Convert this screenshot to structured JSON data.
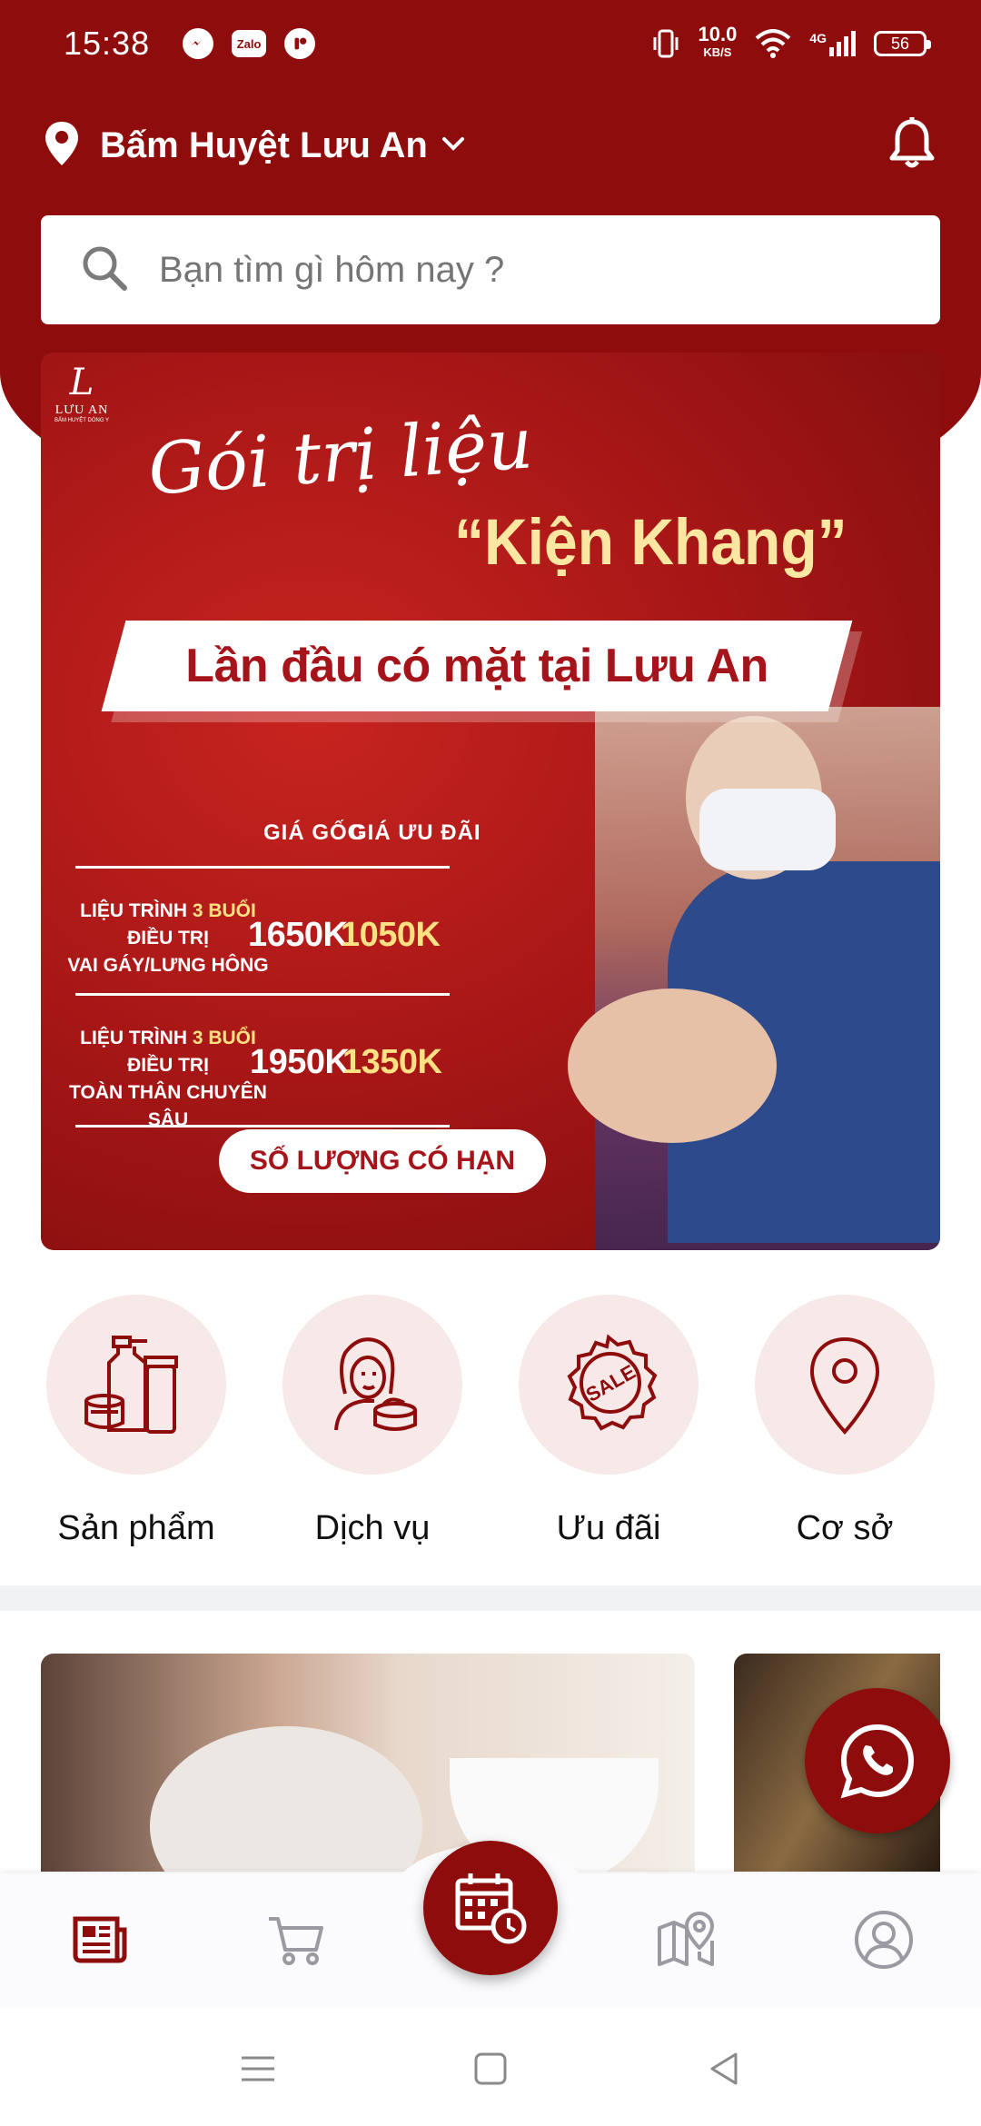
{
  "status_bar": {
    "time": "15:38",
    "net_speed": "10.0",
    "net_unit": "KB/S",
    "signal": "4G",
    "battery": "56",
    "zalo": "Zalo"
  },
  "header": {
    "location": "Bấm Huyệt Lưu An"
  },
  "search": {
    "placeholder": "Bạn tìm gì hôm nay ?"
  },
  "banner": {
    "logo_text": "LƯU AN",
    "logo_sub": "BẤM HUYỆT DÒNG Y",
    "script_title": "Gói trị liệu",
    "title": "“Kiện Khang”",
    "ribbon": "Lần đầu có mặt tại Lưu An",
    "col_original": "GIÁ GỐC",
    "col_sale": "GIÁ ƯU ĐÃI",
    "rows": [
      {
        "line1_a": "LIỆU TRÌNH ",
        "line1_hl": "3 BUỔI",
        "line1_b": " ĐIỀU TRỊ",
        "line2": "VAI GÁY/LƯNG HÔNG",
        "original": "1650K",
        "sale": "1050K"
      },
      {
        "line1_a": "LIỆU TRÌNH ",
        "line1_hl": "3 BUỔI",
        "line1_b": " ĐIỀU TRỊ",
        "line2": "TOÀN THÂN CHUYÊN SÂU",
        "original": "1950K",
        "sale": "1350K"
      }
    ],
    "cta": "SỐ LƯỢNG CÓ HẠN"
  },
  "categories": [
    {
      "label": "Sản phẩm",
      "icon": "cosmetics-icon"
    },
    {
      "label": "Dịch vụ",
      "icon": "beauty-service-icon"
    },
    {
      "label": "Ưu đãi",
      "icon": "sale-badge-icon"
    },
    {
      "label": "Cơ sở",
      "icon": "location-pin-icon"
    }
  ],
  "bottom_nav": [
    {
      "name": "news",
      "icon": "newspaper-icon",
      "active": true
    },
    {
      "name": "cart",
      "icon": "cart-icon",
      "active": false
    },
    {
      "name": "booking",
      "icon": "calendar-clock-icon",
      "active": false
    },
    {
      "name": "map",
      "icon": "map-pin-icon",
      "active": false
    },
    {
      "name": "account",
      "icon": "user-icon",
      "active": false
    }
  ],
  "colors": {
    "brand": "#8e0c0c",
    "banner_red": "#a5141a",
    "category_bg": "#f7e9e8",
    "highlight": "#ffe082"
  }
}
